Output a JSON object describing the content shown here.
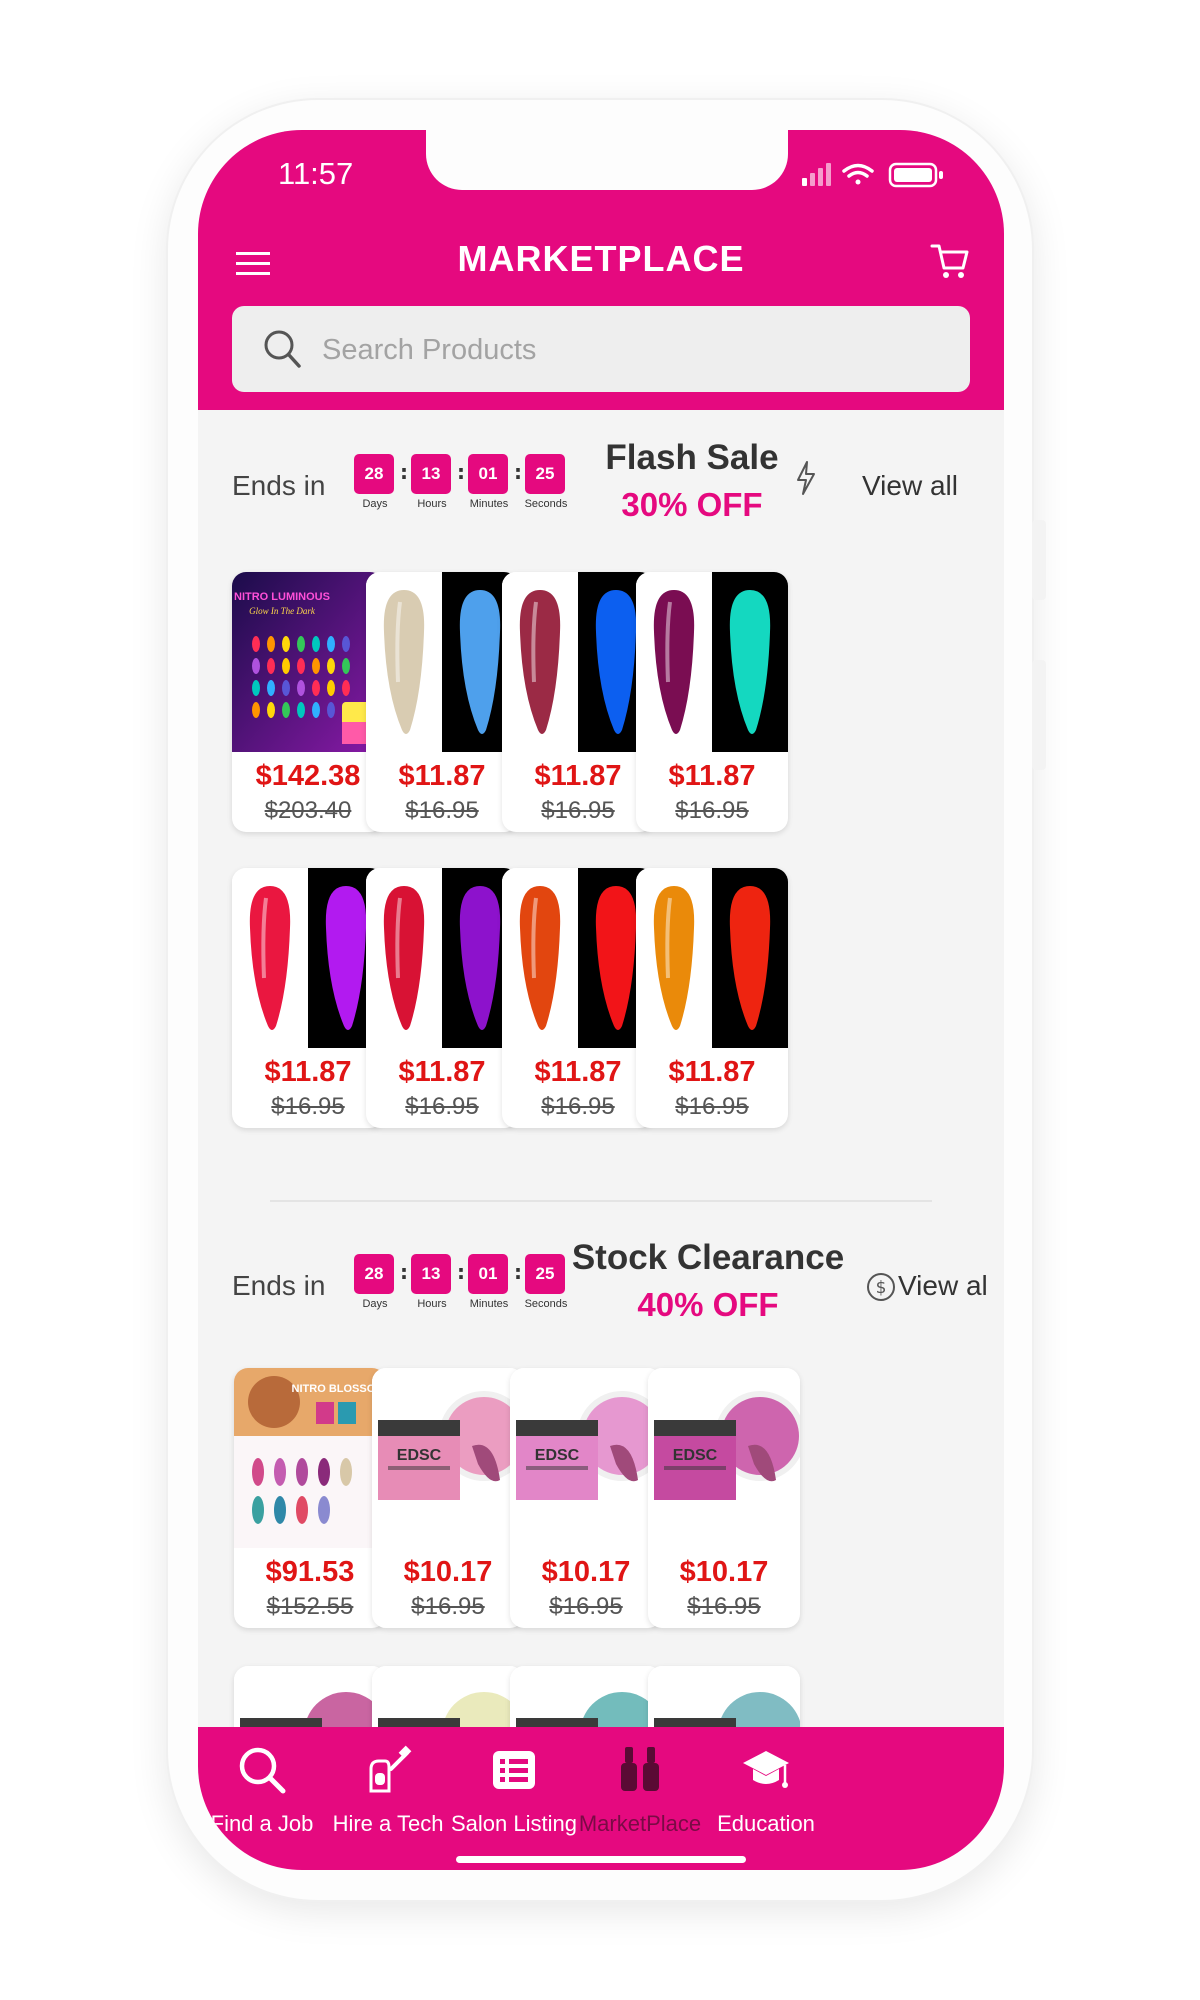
{
  "status_bar": {
    "time": "11:57"
  },
  "header": {
    "title": "MARKETPLACE"
  },
  "search": {
    "placeholder": "Search Products"
  },
  "flash_sale": {
    "ends_in": "Ends in",
    "timer": [
      {
        "value": "28",
        "label": "Days"
      },
      {
        "value": "13",
        "label": "Hours"
      },
      {
        "value": "01",
        "label": "Minutes"
      },
      {
        "value": "25",
        "label": "Seconds"
      }
    ],
    "title": "Flash Sale",
    "discount": "30% OFF",
    "view_all": "View all",
    "products": [
      {
        "price": "$142.38",
        "old_price": "$203.40",
        "image_text_1": "NITRO LUMINOUS",
        "image_text_2": "Glow In The Dark"
      },
      {
        "price": "$11.87",
        "old_price": "$16.95",
        "nail": "#d9ccb2",
        "glow": "#4ea0ec"
      },
      {
        "price": "$11.87",
        "old_price": "$16.95",
        "nail": "#9b2a45",
        "glow": "#0c5ff0"
      },
      {
        "price": "$11.87",
        "old_price": "$16.95",
        "nail": "#7a0d52",
        "glow": "#14d8c0"
      },
      {
        "price": "$11.87",
        "old_price": "$16.95",
        "nail": "#ea1740",
        "glow": "#b21af0"
      },
      {
        "price": "$11.87",
        "old_price": "$16.95",
        "nail": "#d81234",
        "glow": "#8d12cc"
      },
      {
        "price": "$11.87",
        "old_price": "$16.95",
        "nail": "#e2460f",
        "glow": "#f21418"
      },
      {
        "price": "$11.87",
        "old_price": "$16.95",
        "nail": "#ea8a0a",
        "glow": "#ee2410"
      }
    ]
  },
  "stock_clearance": {
    "ends_in": "Ends in",
    "timer": [
      {
        "value": "28",
        "label": "Days"
      },
      {
        "value": "13",
        "label": "Hours"
      },
      {
        "value": "01",
        "label": "Minutes"
      },
      {
        "value": "25",
        "label": "Seconds"
      }
    ],
    "title": "Stock Clearance",
    "discount": "40% OFF",
    "view_all": "View al",
    "products": [
      {
        "price": "$91.53",
        "old_price": "$152.55",
        "image_text_1": "NITRO BLOSSOM"
      },
      {
        "price": "$10.17",
        "old_price": "$16.95",
        "powder": "#e78cb6",
        "brand": "EDSC"
      },
      {
        "price": "$10.17",
        "old_price": "$16.95",
        "powder": "#e286c8",
        "brand": "EDSC"
      },
      {
        "price": "$10.17",
        "old_price": "$16.95",
        "powder": "#c54aa0",
        "brand": "EDSC"
      }
    ]
  },
  "bottom_nav": [
    {
      "label": "Find a Job",
      "icon": "search-icon"
    },
    {
      "label": "Hire a Tech",
      "icon": "nail-polish-hand-icon"
    },
    {
      "label": "Salon Listing",
      "icon": "list-icon"
    },
    {
      "label": "MarketPlace",
      "icon": "nail-polish-bottles-icon",
      "active": true
    },
    {
      "label": "Education",
      "icon": "graduation-cap-icon"
    }
  ],
  "colors": {
    "brand": "#e5097f",
    "price": "#e01515",
    "background": "#f4f4f4"
  }
}
